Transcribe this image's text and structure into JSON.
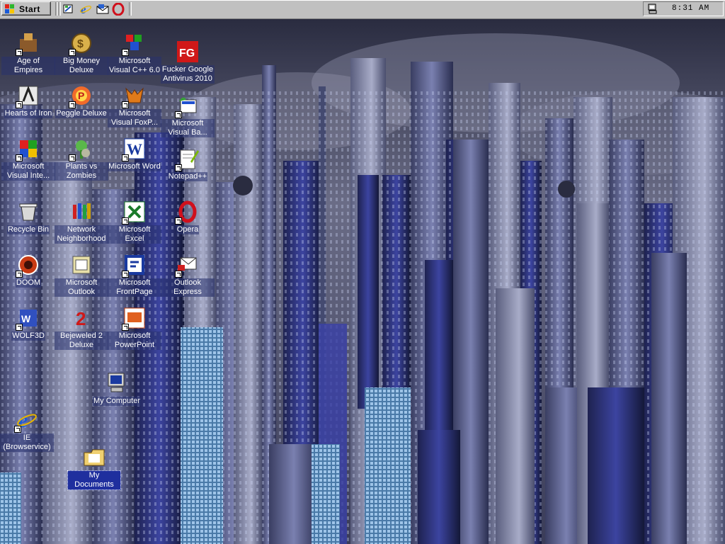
{
  "taskbar": {
    "start_label": "Start",
    "quicklaunch": [
      "show-desktop-icon",
      "ie-icon",
      "outlook-icon",
      "opera-icon"
    ],
    "clock": "8:31 AM",
    "colors": {
      "face": "#c0c0c0",
      "shadow": "#808080"
    }
  },
  "desktop": {
    "icons": [
      {
        "id": "age-of-empires",
        "label": "Age of Empires",
        "icon": "age-of-empires-icon"
      },
      {
        "id": "big-money",
        "label": "Big Money Deluxe",
        "icon": "big-money-icon"
      },
      {
        "id": "visual-cpp",
        "label": "Microsoft Visual C++ 6.0",
        "icon": "visual-cpp-icon"
      },
      {
        "id": "fg-antivirus",
        "label": "Fucker Google Antivirus 2010",
        "icon": "fg-antivirus-icon"
      },
      {
        "id": "hearts-of-iron",
        "label": "Hearts of Iron",
        "icon": "hearts-of-iron-icon"
      },
      {
        "id": "peggle",
        "label": "Peggle Deluxe",
        "icon": "peggle-icon"
      },
      {
        "id": "visual-foxpro",
        "label": "Microsoft Visual FoxP...",
        "icon": "visual-foxpro-icon"
      },
      {
        "id": "visual-basic",
        "label": "Microsoft Visual Ba...",
        "icon": "visual-basic-icon"
      },
      {
        "id": "visual-interdev",
        "label": "Microsoft Visual Inte...",
        "icon": "visual-interdev-icon"
      },
      {
        "id": "plants-vs-zombies",
        "label": "Plants vs Zombies",
        "icon": "plants-vs-zombies-icon"
      },
      {
        "id": "word",
        "label": "Microsoft Word",
        "icon": "word-icon"
      },
      {
        "id": "notepadpp",
        "label": "Notepad++",
        "icon": "notepadpp-icon"
      },
      {
        "id": "recycle-bin",
        "label": "Recycle Bin",
        "icon": "recycle-bin-icon"
      },
      {
        "id": "network",
        "label": "Network Neighborhood",
        "icon": "network-icon"
      },
      {
        "id": "excel",
        "label": "Microsoft Excel",
        "icon": "excel-icon"
      },
      {
        "id": "opera",
        "label": "Opera",
        "icon": "opera-icon"
      },
      {
        "id": "doom",
        "label": "DOOM",
        "icon": "doom-icon"
      },
      {
        "id": "outlook",
        "label": "Microsoft Outlook",
        "icon": "outlook-icon"
      },
      {
        "id": "frontpage",
        "label": "Microsoft FrontPage",
        "icon": "frontpage-icon"
      },
      {
        "id": "outlook-express",
        "label": "Outlook Express",
        "icon": "outlook-express-icon"
      },
      {
        "id": "wolf3d",
        "label": "WOLF3D",
        "icon": "wolf3d-icon"
      },
      {
        "id": "bejeweled",
        "label": "Bejeweled 2 Deluxe",
        "icon": "bejeweled-icon"
      },
      {
        "id": "powerpoint",
        "label": "Microsoft PowerPoint",
        "icon": "powerpoint-icon"
      },
      {
        "id": "my-computer",
        "label": "My Computer",
        "icon": "my-computer-icon"
      },
      {
        "id": "ie-browservice",
        "label": "IE (Browservice)",
        "icon": "ie-icon"
      },
      {
        "id": "my-documents",
        "label": "My Documents",
        "icon": "my-documents-icon"
      }
    ]
  },
  "wallpaper": {
    "subject": "futuristic-city-wallpaper"
  }
}
